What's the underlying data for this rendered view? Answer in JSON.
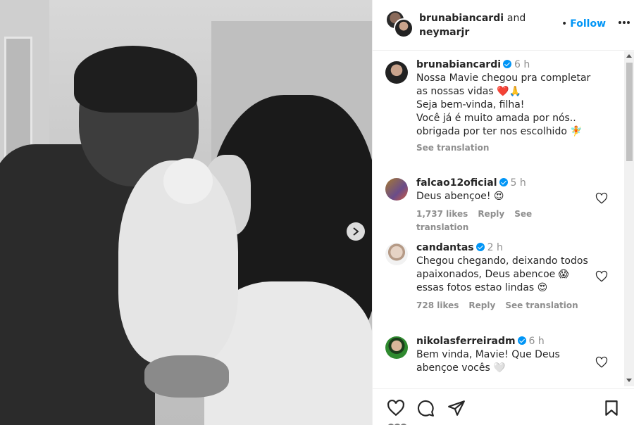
{
  "header": {
    "user1": "brunabiancardi",
    "and": "and",
    "user2": "neymarjr",
    "follow_dot": "•",
    "follow": "Follow"
  },
  "caption": {
    "username": "brunabiancardi",
    "time": "6 h",
    "line1": "Nossa Mavie chegou pra completar as nossas vidas ❤️🙏",
    "line2": "Seja bem-vinda, filha!",
    "line3": "Você já é muito amada por nós..",
    "line4": "obrigada por ter nos escolhido 🧚",
    "see_translation": "See translation"
  },
  "comments": [
    {
      "username": "falcao12oficial",
      "time": "5 h",
      "text": "Deus abençoe! 😍",
      "likes": "1,737 likes",
      "reply": "Reply",
      "see_translation": "See translation"
    },
    {
      "username": "candantas",
      "time": "2 h",
      "text": "Chegou chegando, deixando todos apaixonados, Deus abencoe 😱 essas fotos estao lindas 😍",
      "likes": "728 likes",
      "reply": "Reply",
      "see_translation": "See translation"
    },
    {
      "username": "nikolasferreiradm",
      "time": "6 h",
      "text": "Bem vinda, Mavie! Que Deus abençoe vocês 🤍"
    }
  ],
  "icons": {
    "like": "heart-outline-icon",
    "comment": "comment-icon",
    "share": "share-icon",
    "save": "bookmark-icon",
    "verified": "verified-badge-icon",
    "next": "chevron-right-icon",
    "more": "more-icon"
  },
  "colors": {
    "accent": "#0095f6",
    "text": "#262626",
    "muted": "#8e8e8e"
  }
}
